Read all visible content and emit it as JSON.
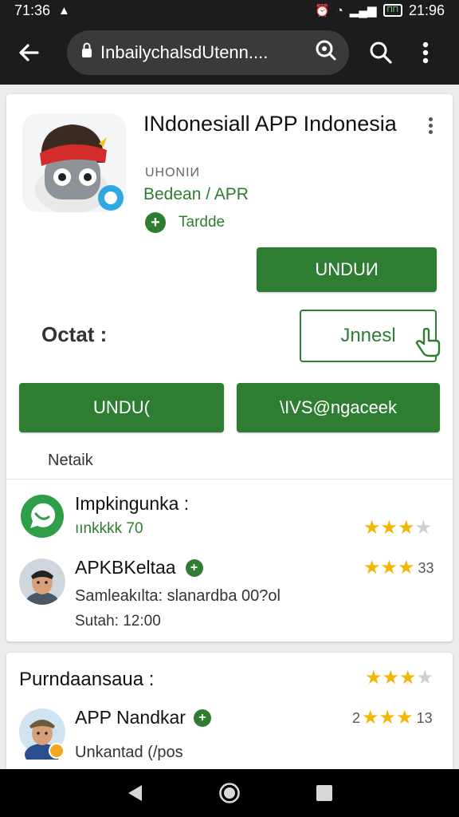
{
  "status_bar": {
    "time_left": "71:36",
    "battery_text": "ΠΠ",
    "time_right": "21:96"
  },
  "browser": {
    "url": "InbailychalsdUtenn...."
  },
  "app": {
    "title": "INdonesiall APP Indonesia",
    "developer": "UHONIИ",
    "category": "Bedean / APR",
    "badge_text": "Tardde",
    "install_top_label": "UNDUИ",
    "detail_label": "Octat :",
    "outline_button_label": "Jnnesl",
    "install_left_label": "UNDU(",
    "secondary_button_label": "\\IVS@ngaceek",
    "sub_label": "Netaik"
  },
  "reviews": [
    {
      "name": "Impkingunka :",
      "sub": "ıınkkkk 70",
      "rating": 3,
      "rating_out_of": 4,
      "count": ""
    },
    {
      "name": "APKBKeltaa",
      "text": "Samleakılta: slanardba 00?ol",
      "time": "Sutah: 12:00",
      "rating": 3,
      "rating_out_of": 3,
      "count": "33"
    }
  ],
  "section2": {
    "title": "Purndaansaua :",
    "rating": 3,
    "rating_out_of": 4,
    "review": {
      "name": "APP Nandkar",
      "prefix": "2",
      "count": "13",
      "text": "Unkantad (/pos",
      "rating": 3
    }
  },
  "colors": {
    "accent_green": "#2e7d32",
    "star_yellow": "#f2b705",
    "bar_dark": "#1c1c1e"
  },
  "icons": [
    "back-arrow-icon",
    "lock-icon",
    "lens-icon",
    "search-icon",
    "more-vert-icon",
    "whatsapp-icon",
    "hand-pointer-icon",
    "nav-back-icon",
    "nav-home-icon",
    "nav-recents-icon"
  ]
}
